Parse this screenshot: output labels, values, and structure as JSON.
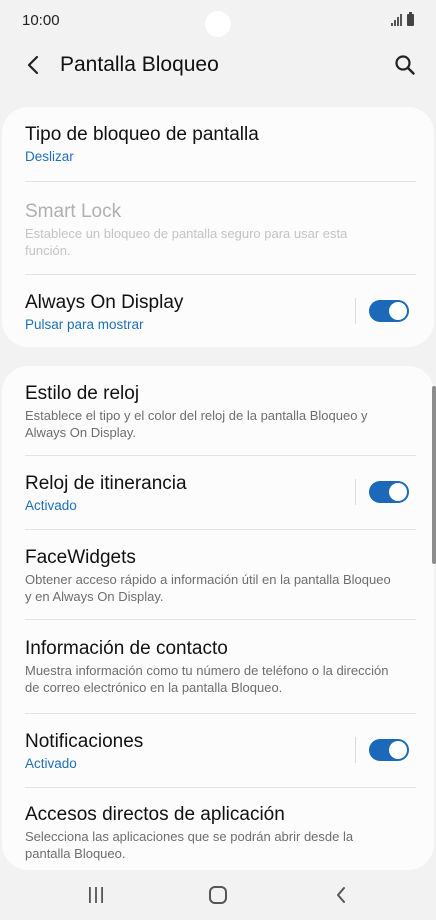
{
  "status_bar": {
    "time": "10:00",
    "icons": [
      "signal-icon",
      "battery-icon"
    ]
  },
  "header": {
    "title": "Pantalla Bloqueo",
    "back_icon": "chevron-left-icon",
    "search_icon": "search-icon"
  },
  "section1": {
    "items": [
      {
        "title": "Tipo de bloqueo de pantalla",
        "subtitle": "Deslizar"
      },
      {
        "title": "Smart Lock",
        "description": "Establece un bloqueo de pantalla seguro para usar esta función.",
        "enabled": false
      },
      {
        "title": "Always On Display",
        "subtitle": "Pulsar para mostrar",
        "toggle_on": true
      }
    ]
  },
  "section2": {
    "items": [
      {
        "title": "Estilo de reloj",
        "description": "Establece el tipo y el color del reloj de la pantalla Bloqueo y Always On Display."
      },
      {
        "title": "Reloj de itinerancia",
        "subtitle": "Activado",
        "toggle_on": true
      },
      {
        "title": "FaceWidgets",
        "description": "Obtener acceso rápido a información útil en la pantalla Bloqueo y en Always On Display."
      },
      {
        "title": "Información de contacto",
        "description": "Muestra información como tu número de teléfono o la dirección de correo electrónico en la pantalla Bloqueo."
      },
      {
        "title": "Notificaciones",
        "subtitle": "Activado",
        "toggle_on": true
      },
      {
        "title": "Accesos directos de aplicación",
        "description": "Selecciona las aplicaciones que se podrán abrir desde la pantalla Bloqueo."
      }
    ]
  },
  "nav_bar": {
    "icons": [
      "recent-apps-icon",
      "home-icon",
      "back-icon"
    ]
  },
  "colors": {
    "accent": "#1c68b9",
    "link_blue": "#1f6fb4",
    "background": "#f2f2f2",
    "card": "#fcfcfc"
  }
}
